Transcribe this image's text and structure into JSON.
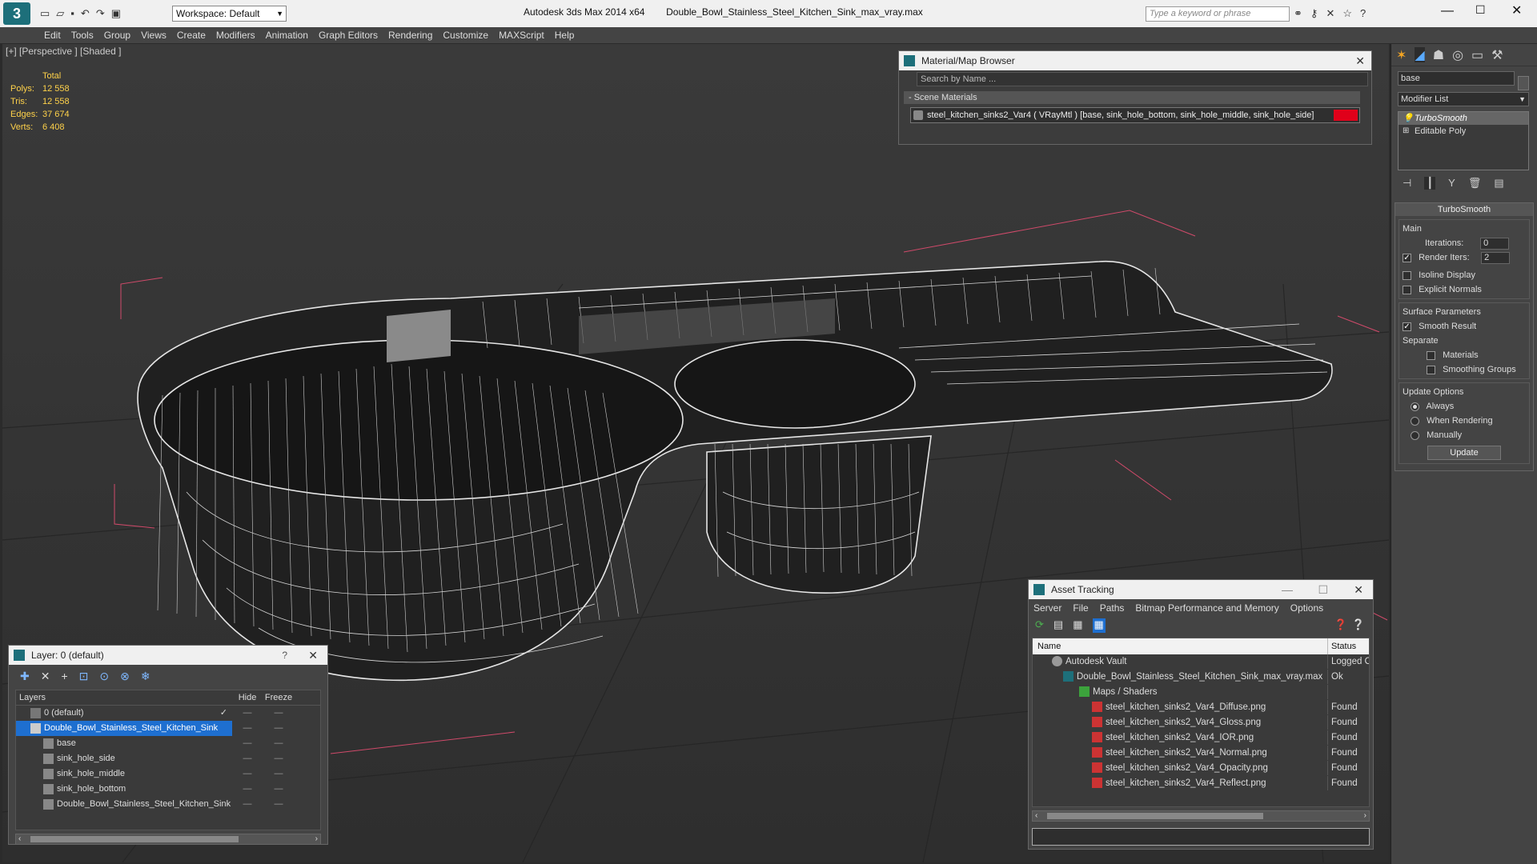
{
  "app": {
    "title": "Autodesk 3ds Max  2014 x64",
    "file": "Double_Bowl_Stainless_Steel_Kitchen_Sink_max_vray.max",
    "workspace": "Workspace: Default",
    "search_placeholder": "Type a keyword or phrase"
  },
  "menu": [
    "Edit",
    "Tools",
    "Group",
    "Views",
    "Create",
    "Modifiers",
    "Animation",
    "Graph Editors",
    "Rendering",
    "Customize",
    "MAXScript",
    "Help"
  ],
  "viewport": {
    "label": "[+] [Perspective ] [Shaded ]",
    "stats": {
      "header": "Total",
      "rows": [
        {
          "k": "Polys:",
          "v": "12 558"
        },
        {
          "k": "Tris:",
          "v": "12 558"
        },
        {
          "k": "Edges:",
          "v": "37 674"
        },
        {
          "k": "Verts:",
          "v": "6 408"
        }
      ]
    }
  },
  "material_browser": {
    "title": "Material/Map Browser",
    "search_placeholder": "Search by Name ...",
    "section": "- Scene Materials",
    "item": "steel_kitchen_sinks2_Var4 ( VRayMtl ) [base, sink_hole_bottom, sink_hole_middle, sink_hole_side]",
    "item_color": "#e0001a"
  },
  "command_panel": {
    "name_value": "base",
    "modifier_list": "Modifier List",
    "stack": [
      "TurboSmooth",
      "Editable Poly"
    ],
    "rollout_title": "TurboSmooth",
    "main_label": "Main",
    "iterations_label": "Iterations:",
    "iterations_value": "0",
    "render_iters_label": "Render Iters:",
    "render_iters_value": "2",
    "render_iters_checked": true,
    "isoline": "Isoline Display",
    "explicit_normals": "Explicit Normals",
    "surface_params": "Surface Parameters",
    "smooth_result": "Smooth Result",
    "separate": "Separate",
    "materials": "Materials",
    "smoothing_groups": "Smoothing Groups",
    "update_options": "Update Options",
    "always": "Always",
    "when_rendering": "When Rendering",
    "manually": "Manually",
    "update_button": "Update"
  },
  "layer_window": {
    "title": "Layer: 0 (default)",
    "help": "?",
    "columns": {
      "layers": "Layers",
      "hide": "Hide",
      "freeze": "Freeze"
    },
    "rows": [
      {
        "name": "0 (default)",
        "indent": 1,
        "selected": false
      },
      {
        "name": "Double_Bowl_Stainless_Steel_Kitchen_Sink",
        "indent": 1,
        "selected": true
      },
      {
        "name": "base",
        "indent": 2,
        "selected": false
      },
      {
        "name": "sink_hole_side",
        "indent": 2,
        "selected": false
      },
      {
        "name": "sink_hole_middle",
        "indent": 2,
        "selected": false
      },
      {
        "name": "sink_hole_bottom",
        "indent": 2,
        "selected": false
      },
      {
        "name": "Double_Bowl_Stainless_Steel_Kitchen_Sink",
        "indent": 2,
        "selected": false
      }
    ]
  },
  "asset_tracking": {
    "title": "Asset Tracking",
    "menu": [
      "Server",
      "File",
      "Paths",
      "Bitmap Performance and Memory",
      "Options"
    ],
    "columns": {
      "name": "Name",
      "status": "Status"
    },
    "rows": [
      {
        "name": "Autodesk Vault",
        "status": "Logged O",
        "indent": 1
      },
      {
        "name": "Double_Bowl_Stainless_Steel_Kitchen_Sink_max_vray.max",
        "status": "Ok",
        "indent": 2
      },
      {
        "name": "Maps / Shaders",
        "status": "",
        "indent": 3
      },
      {
        "name": "steel_kitchen_sinks2_Var4_Diffuse.png",
        "status": "Found",
        "indent": 4
      },
      {
        "name": "steel_kitchen_sinks2_Var4_Gloss.png",
        "status": "Found",
        "indent": 4
      },
      {
        "name": "steel_kitchen_sinks2_Var4_IOR.png",
        "status": "Found",
        "indent": 4
      },
      {
        "name": "steel_kitchen_sinks2_Var4_Normal.png",
        "status": "Found",
        "indent": 4
      },
      {
        "name": "steel_kitchen_sinks2_Var4_Opacity.png",
        "status": "Found",
        "indent": 4
      },
      {
        "name": "steel_kitchen_sinks2_Var4_Reflect.png",
        "status": "Found",
        "indent": 4
      }
    ]
  }
}
